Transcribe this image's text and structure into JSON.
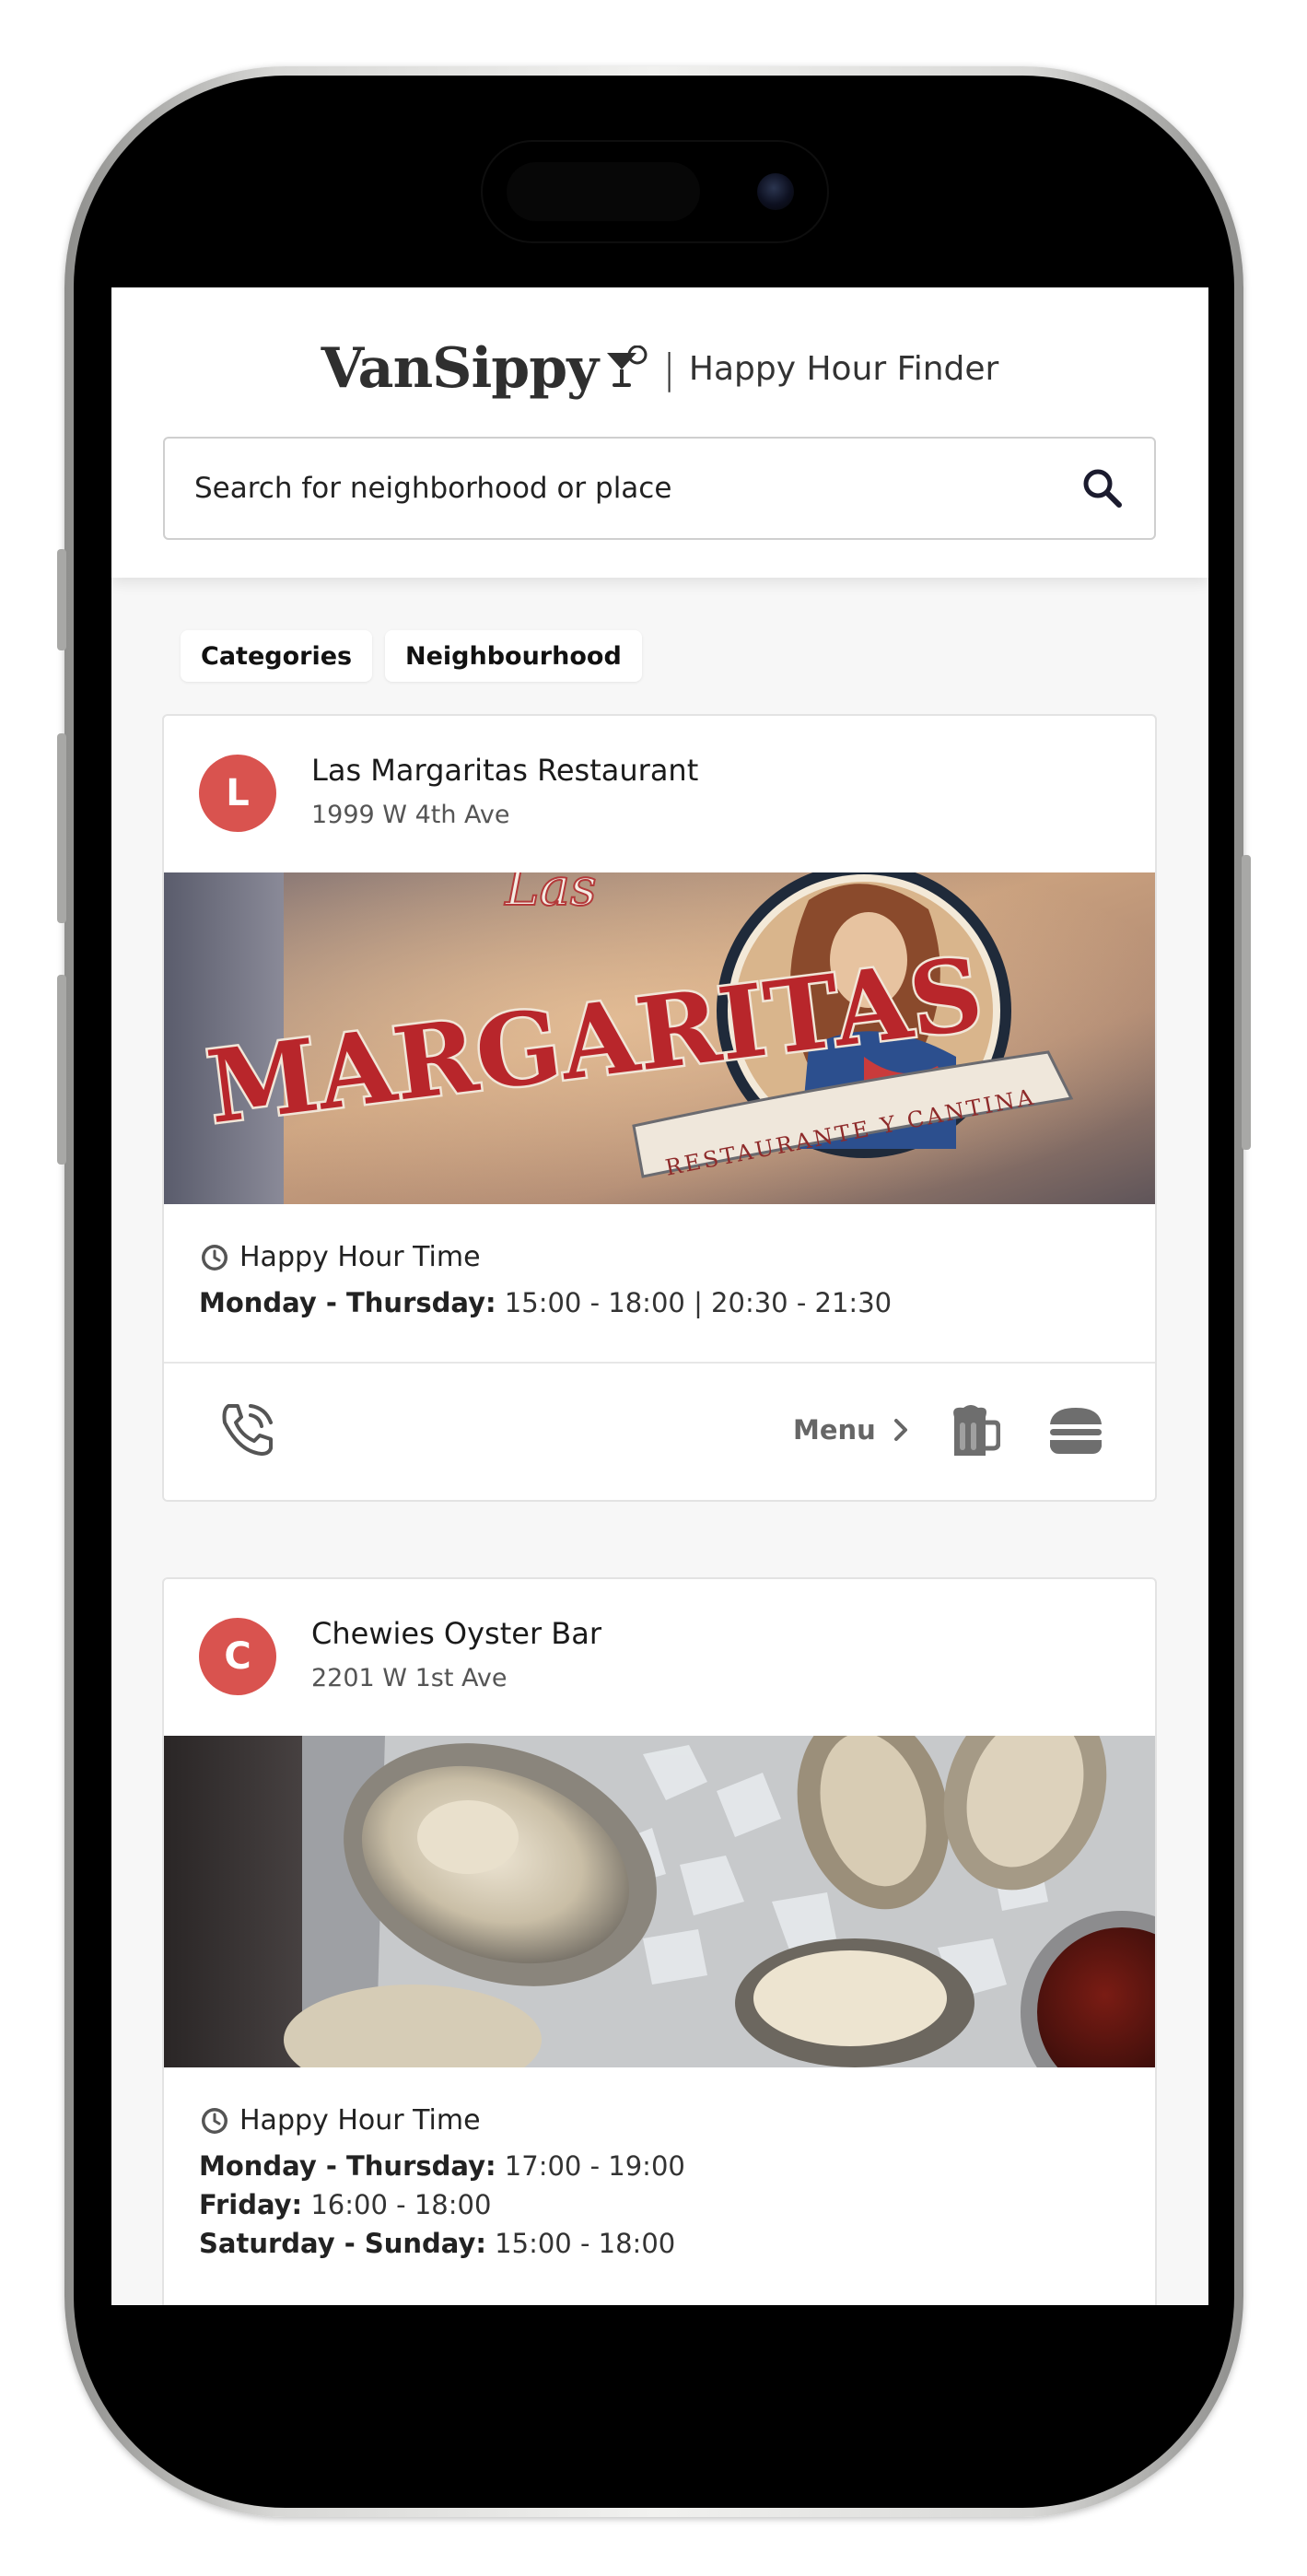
{
  "app": {
    "logo": "VanSippy",
    "separator": "|",
    "tagline": "Happy Hour Finder"
  },
  "search": {
    "placeholder": "Search for neighborhood or place"
  },
  "filters": [
    {
      "label": "Categories"
    },
    {
      "label": "Neighbourhood"
    }
  ],
  "venues": [
    {
      "initial": "L",
      "name": "Las Margaritas Restaurant",
      "address": "1999 W 4th Ave",
      "image_sign_text": "Las MARGARITAS",
      "image_banner_text": "RESTAURANTE Y CANTINA",
      "happy_hour_title": "Happy Hour Time",
      "happy_hours": [
        {
          "days": "Monday - Thursday:",
          "times": "15:00 - 18:00 | 20:30 - 21:30"
        }
      ],
      "menu_label": "Menu"
    },
    {
      "initial": "C",
      "name": "Chewies Oyster Bar",
      "address": "2201 W 1st Ave",
      "happy_hour_title": "Happy Hour Time",
      "happy_hours": [
        {
          "days": "Monday - Thursday:",
          "times": "17:00 - 19:00"
        },
        {
          "days": "Friday:",
          "times": "16:00 - 18:00"
        },
        {
          "days": "Saturday - Sunday:",
          "times": "15:00 - 18:00"
        }
      ]
    }
  ],
  "colors": {
    "avatar": "#d9534f",
    "text": "#222222",
    "muted": "#666666"
  },
  "icons": [
    "martini-glass-icon",
    "search-icon",
    "clock-icon",
    "phone-icon",
    "chevron-right-icon",
    "beer-mug-icon",
    "burger-icon"
  ]
}
